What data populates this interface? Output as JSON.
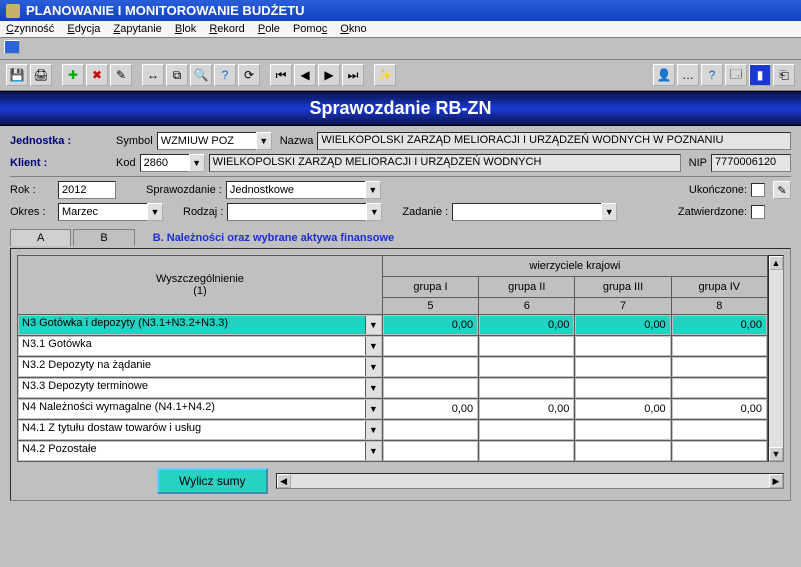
{
  "window": {
    "title": "PLANOWANIE I MONITOROWANIE BUDŻETU"
  },
  "menu": {
    "czynnosc": "Czynność",
    "edycja": "Edycja",
    "zapytanie": "Zapytanie",
    "blok": "Blok",
    "rekord": "Rekord",
    "pole": "Pole",
    "pomoc": "Pomoc",
    "okno": "Okno"
  },
  "banner": "Sprawozdanie RB-ZN",
  "form": {
    "jednostka_label": "Jednostka :",
    "symbol_label": "Symbol",
    "symbol_value": "WZMIUW POZ",
    "nazwa_label": "Nazwa",
    "nazwa_value": "WIELKOPOLSKI ZARZĄD MELIORACJI I URZĄDZEŃ WODNYCH W POZNANIU",
    "klient_label": "Klient :",
    "kod_label": "Kod",
    "kod_value": "2860",
    "klient_value": "WIELKOPOLSKI ZARZĄD MELIORACJI I URZĄDZEŃ WODNYCH",
    "nip_label": "NIP",
    "nip_value": "7770006120",
    "rok_label": "Rok :",
    "rok_value": "2012",
    "sprawozdanie_label": "Sprawozdanie :",
    "sprawozdanie_value": "Jednostkowe",
    "okres_label": "Okres :",
    "okres_value": "Marzec",
    "rodzaj_label": "Rodzaj :",
    "rodzaj_value": "",
    "zadanie_label": "Zadanie :",
    "zadanie_value": "",
    "ukonczone_label": "Ukończone:",
    "zatwierdzone_label": "Zatwierdzone:"
  },
  "tabs": {
    "a": "A",
    "b": "B",
    "b_title": "B. Należności oraz wybrane aktywa finansowe"
  },
  "grid": {
    "head_wys": "Wyszczególnienie\n(1)",
    "head_wierz": "wierzyciele krajowi",
    "group_labels": [
      "grupa I",
      "grupa II",
      "grupa III",
      "grupa IV"
    ],
    "sub_labels": [
      "5",
      "6",
      "7",
      "8"
    ],
    "rows": [
      {
        "label": "N3 Gotówka i depozyty (N3.1+N3.2+N3.3)",
        "values": [
          "0,00",
          "0,00",
          "0,00",
          "0,00"
        ],
        "selected": true
      },
      {
        "label": "N3.1 Gotówka",
        "values": [
          "",
          "",
          "",
          ""
        ]
      },
      {
        "label": "N3.2 Depozyty na żądanie",
        "values": [
          "",
          "",
          "",
          ""
        ]
      },
      {
        "label": "N3.3 Depozyty terminowe",
        "values": [
          "",
          "",
          "",
          ""
        ]
      },
      {
        "label": "N4 Należności wymagalne (N4.1+N4.2)",
        "values": [
          "0,00",
          "0,00",
          "0,00",
          "0,00"
        ]
      },
      {
        "label": "N4.1 Z tytułu dostaw towarów i usług",
        "values": [
          "",
          "",
          "",
          ""
        ]
      },
      {
        "label": "N4.2 Pozostałe",
        "values": [
          "",
          "",
          "",
          ""
        ]
      }
    ]
  },
  "buttons": {
    "wylicz": "Wylicz sumy"
  }
}
